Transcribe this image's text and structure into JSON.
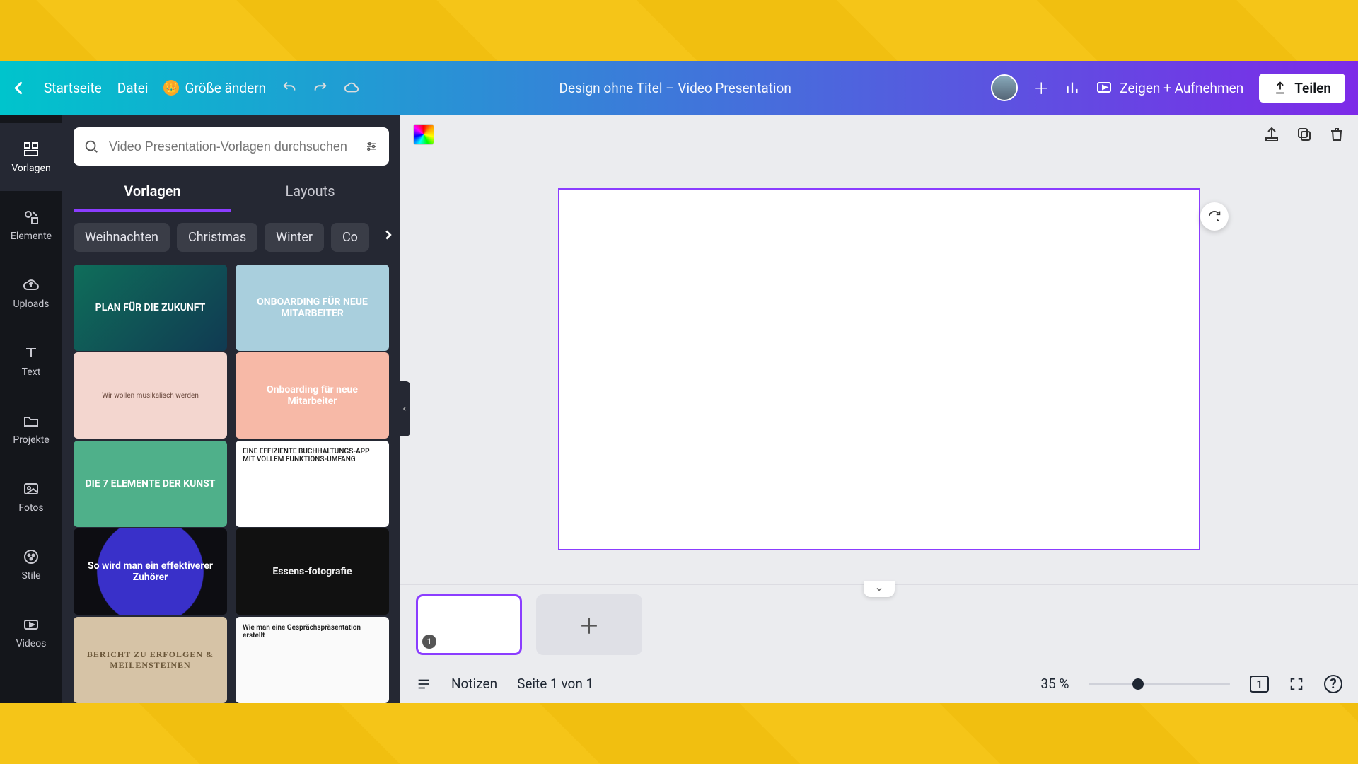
{
  "topbar": {
    "home_label": "Startseite",
    "file_label": "Datei",
    "resize_label": "Größe ändern",
    "title": "Design ohne Titel – Video Presentation",
    "present_label": "Zeigen + Aufnehmen",
    "share_label": "Teilen"
  },
  "rail": {
    "items": [
      {
        "label": "Vorlagen",
        "icon": "templates"
      },
      {
        "label": "Elemente",
        "icon": "elements"
      },
      {
        "label": "Uploads",
        "icon": "uploads"
      },
      {
        "label": "Text",
        "icon": "text"
      },
      {
        "label": "Projekte",
        "icon": "projects"
      },
      {
        "label": "Fotos",
        "icon": "photos"
      },
      {
        "label": "Stile",
        "icon": "styles"
      },
      {
        "label": "Videos",
        "icon": "videos"
      }
    ]
  },
  "panel": {
    "search_placeholder": "Video Presentation-Vorlagen durchsuchen",
    "tabs": {
      "templates": "Vorlagen",
      "layouts": "Layouts"
    },
    "chips": [
      "Weihnachten",
      "Christmas",
      "Winter",
      "Co"
    ],
    "templates": [
      {
        "title": "PLAN FÜR DIE ZUKUNFT",
        "bg": "linear-gradient(135deg,#0f6e5a,#103a52)",
        "fg": "#fff"
      },
      {
        "title": "ONBOARDING FÜR NEUE MITARBEITER",
        "bg": "#a9cfdd",
        "fg": "#fff"
      },
      {
        "title": "Wir wollen musikalisch werden",
        "bg": "#f3d6cf",
        "fg": "#6b4a3e"
      },
      {
        "title": "Onboarding für neue Mitarbeiter",
        "bg": "#f7b9a7",
        "fg": "#fff"
      },
      {
        "title": "DIE 7 ELEMENTE DER KUNST",
        "bg": "#4fb08a",
        "fg": "#fff"
      },
      {
        "title": "EINE EFFIZIENTE BUCHHALTUNGS-APP MIT VOLLEM FUNKTIONS-UMFANG",
        "bg": "#ffffff",
        "fg": "#222"
      },
      {
        "title": "So wird man ein effektiverer Zuhörer",
        "bg": "radial-gradient(circle at center,#3930c9 60%,#0d0d12 61%)",
        "fg": "#fff"
      },
      {
        "title": "Essens-fotografie",
        "bg": "#111",
        "fg": "#eee"
      },
      {
        "title": "BERICHT ZU ERFOLGEN & MEILENSTEINEN",
        "bg": "#d6c3a6",
        "fg": "#6a5638"
      },
      {
        "title": "Wie man eine Gesprächspräsentation erstellt",
        "bg": "#fafafa",
        "fg": "#222"
      }
    ]
  },
  "timeline": {
    "current_page_num": "1"
  },
  "footer": {
    "notes_label": "Notizen",
    "page_indicator": "Seite 1 von 1",
    "zoom_label": "35 %",
    "grid_count": "1",
    "help": "?"
  }
}
